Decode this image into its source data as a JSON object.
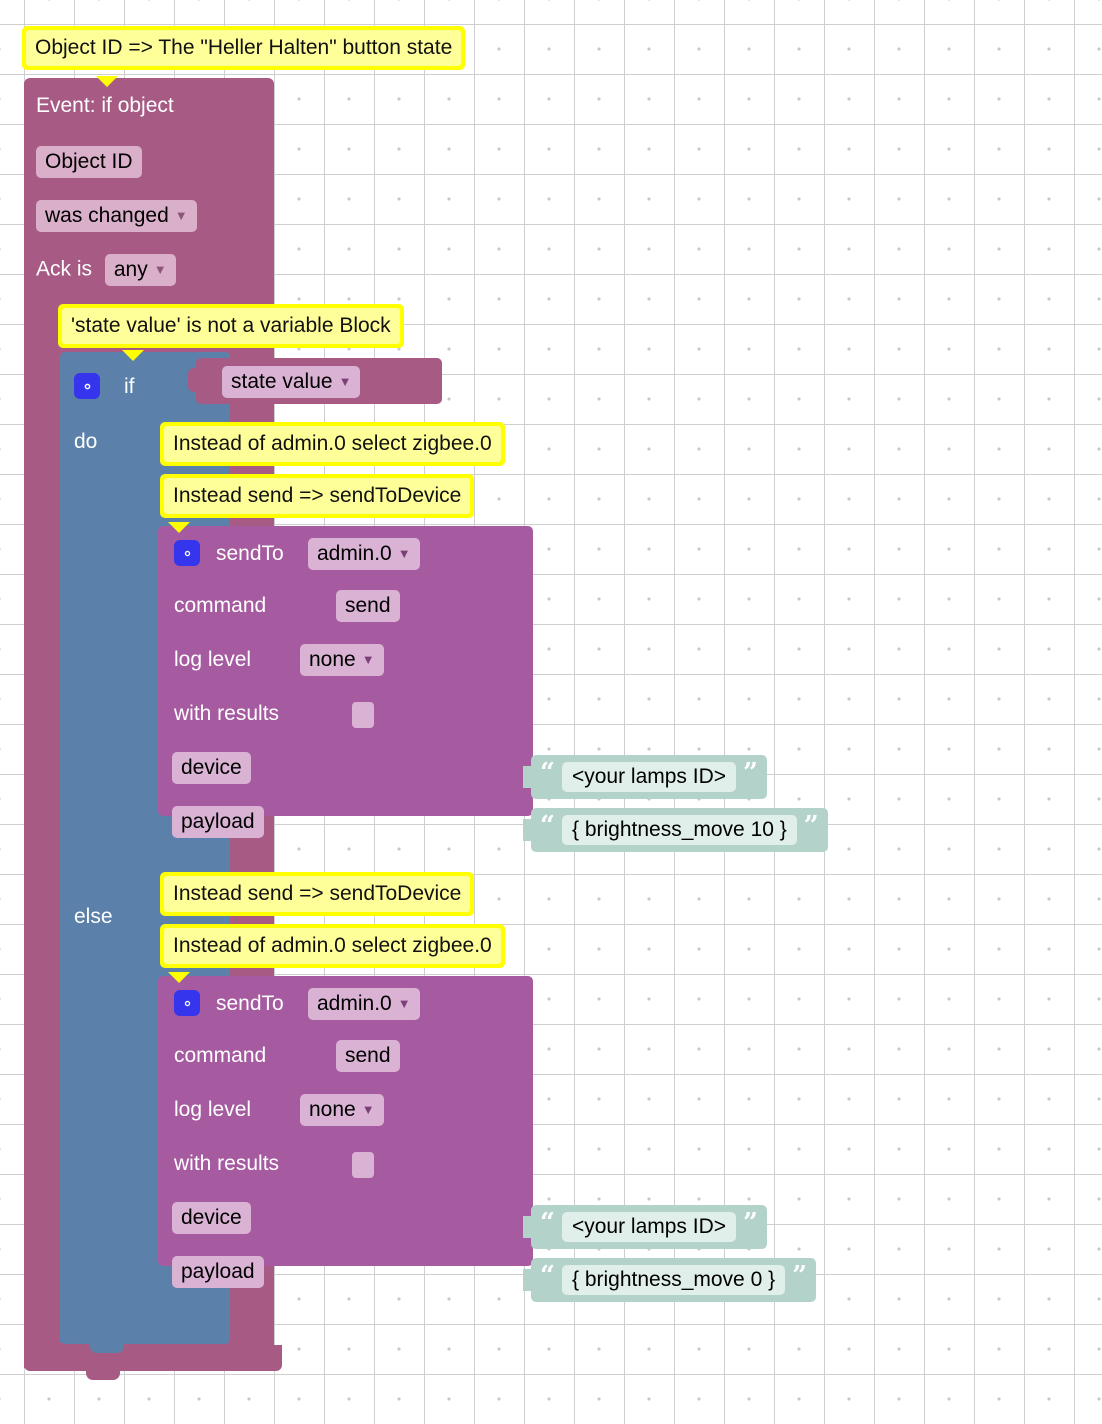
{
  "workspace": {
    "title": "ioBroker Blockly script",
    "colors": {
      "event_block": "#a65a84",
      "if_block": "#5b81aa",
      "send_block": "#a65aa0",
      "text_block": "#b3d2c9",
      "warning": "#ffff00",
      "warning_inner": "#ffff99",
      "field": "#d9afc9",
      "gear": "#3535ee",
      "grid_dot": "#c9c9c9"
    }
  },
  "top_comment": {
    "text": "Object ID => The \"Heller Halten\" button state"
  },
  "event_block": {
    "title": "Event: if object",
    "object_id_field": "Object ID",
    "condition_field": "was changed",
    "ack_label": "Ack is",
    "ack_field": "any"
  },
  "if_comment": {
    "text": "'state value' is not a variable Block"
  },
  "if_block": {
    "gear_icon": "gear-icon",
    "if_label": "if",
    "condition_value": "state value",
    "do_label": "do",
    "else_label": "else"
  },
  "do_branch": {
    "comments": [
      "Instead of admin.0 select zigbee.0",
      "Instead send => sendToDevice"
    ],
    "send_block": {
      "gear_icon": "gear-icon",
      "sendto_label": "sendTo",
      "sendto_value": "admin.0",
      "command_label": "command",
      "command_value": "send",
      "log_level_label": "log level",
      "log_level_value": "none",
      "with_results_label": "with results",
      "with_results_checked": false,
      "device_label": "device",
      "payload_label": "payload"
    },
    "device_text": "<your lamps ID>",
    "payload_text": "{ brightness_move 10 }"
  },
  "else_branch": {
    "comments": [
      "Instead send => sendToDevice",
      "Instead of admin.0 select zigbee.0"
    ],
    "send_block": {
      "gear_icon": "gear-icon",
      "sendto_label": "sendTo",
      "sendto_value": "admin.0",
      "command_label": "command",
      "command_value": "send",
      "log_level_label": "log level",
      "log_level_value": "none",
      "with_results_label": "with results",
      "with_results_checked": false,
      "device_label": "device",
      "payload_label": "payload"
    },
    "device_text": "<your lamps ID>",
    "payload_text": "{ brightness_move 0 }"
  }
}
